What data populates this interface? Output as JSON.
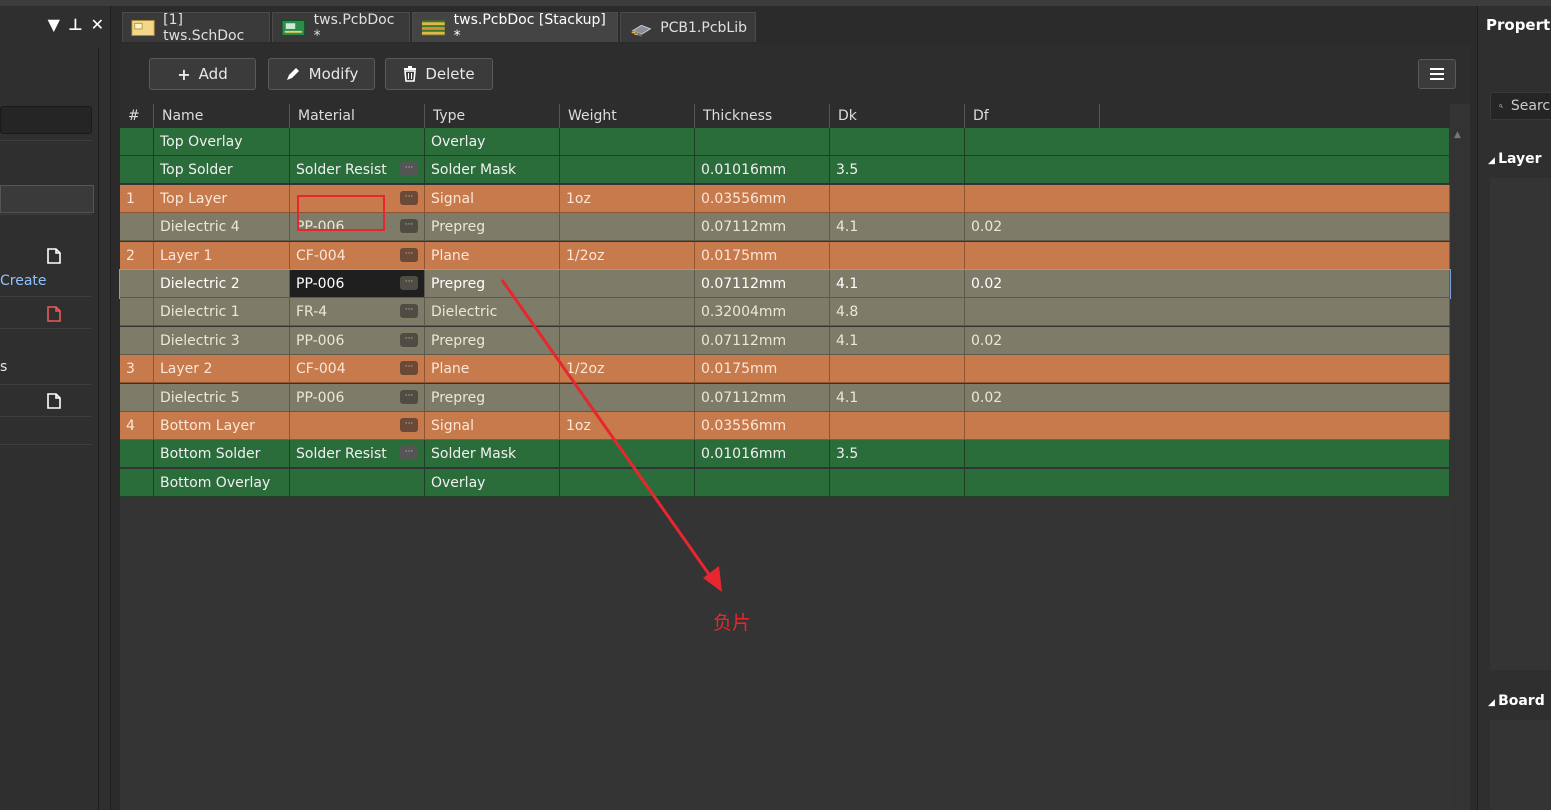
{
  "left_panel": {
    "create_label": "Create",
    "s_label": "s"
  },
  "tabs": [
    {
      "label": "[1] tws.SchDoc",
      "icon": "schematic-doc-icon"
    },
    {
      "label": "tws.PcbDoc *",
      "icon": "pcb-doc-icon"
    },
    {
      "label": "tws.PcbDoc [Stackup] *",
      "icon": "stackup-doc-icon"
    },
    {
      "label": "PCB1.PcbLib",
      "icon": "pcb-lib-icon"
    }
  ],
  "toolbar": {
    "add_label": "Add",
    "modify_label": "Modify",
    "delete_label": "Delete"
  },
  "table": {
    "columns": [
      "#",
      "Name",
      "Material",
      "Type",
      "Weight",
      "Thickness",
      "Dk",
      "Df"
    ],
    "rows": [
      {
        "num": "",
        "name": "Top Overlay",
        "material": "",
        "type": "Overlay",
        "weight": "",
        "thickness": "",
        "dk": "",
        "df": "",
        "color": "green"
      },
      {
        "num": "",
        "name": "Top Solder",
        "material": "Solder Resist",
        "type": "Solder Mask",
        "weight": "",
        "thickness": "0.01016mm",
        "dk": "3.5",
        "df": "",
        "color": "green"
      },
      {
        "num": "1",
        "name": "Top Layer",
        "material": "",
        "type": "Signal",
        "weight": "1oz",
        "thickness": "0.03556mm",
        "dk": "",
        "df": "",
        "color": "orange"
      },
      {
        "num": "",
        "name": "Dielectric 4",
        "material": "PP-006",
        "type": "Prepreg",
        "weight": "",
        "thickness": "0.07112mm",
        "dk": "4.1",
        "df": "0.02",
        "color": "gray"
      },
      {
        "num": "2",
        "name": "Layer 1",
        "material": "CF-004",
        "type": "Plane",
        "weight": "1/2oz",
        "thickness": "0.0175mm",
        "dk": "",
        "df": "",
        "color": "orange"
      },
      {
        "num": "",
        "name": "Dielectric 2",
        "material": "PP-006",
        "type": "Prepreg",
        "weight": "",
        "thickness": "0.07112mm",
        "dk": "4.1",
        "df": "0.02",
        "color": "gray"
      },
      {
        "num": "",
        "name": "Dielectric 1",
        "material": "FR-4",
        "type": "Dielectric",
        "weight": "",
        "thickness": "0.32004mm",
        "dk": "4.8",
        "df": "",
        "color": "gray"
      },
      {
        "num": "",
        "name": "Dielectric 3",
        "material": "PP-006",
        "type": "Prepreg",
        "weight": "",
        "thickness": "0.07112mm",
        "dk": "4.1",
        "df": "0.02",
        "color": "gray"
      },
      {
        "num": "3",
        "name": "Layer 2",
        "material": "CF-004",
        "type": "Plane",
        "weight": "1/2oz",
        "thickness": "0.0175mm",
        "dk": "",
        "df": "",
        "color": "orange"
      },
      {
        "num": "",
        "name": "Dielectric 5",
        "material": "PP-006",
        "type": "Prepreg",
        "weight": "",
        "thickness": "0.07112mm",
        "dk": "4.1",
        "df": "0.02",
        "color": "gray"
      },
      {
        "num": "4",
        "name": "Bottom Layer",
        "material": "",
        "type": "Signal",
        "weight": "1oz",
        "thickness": "0.03556mm",
        "dk": "",
        "df": "",
        "color": "orange"
      },
      {
        "num": "",
        "name": "Bottom Solder",
        "material": "Solder Resist",
        "type": "Solder Mask",
        "weight": "",
        "thickness": "0.01016mm",
        "dk": "3.5",
        "df": "",
        "color": "green"
      },
      {
        "num": "",
        "name": "Bottom Overlay",
        "material": "",
        "type": "Overlay",
        "weight": "",
        "thickness": "",
        "dk": "",
        "df": "",
        "color": "green"
      }
    ]
  },
  "annotation": {
    "text": "负片",
    "color": "#e8262d"
  },
  "right_panel": {
    "title": "Properties",
    "search_placeholder": "Search",
    "section_layer": "Layer",
    "section_board": "Board"
  },
  "colors": {
    "green_row": "#2b6c3b",
    "orange_row": "#c77a4c",
    "gray_row": "#7e7b69"
  }
}
